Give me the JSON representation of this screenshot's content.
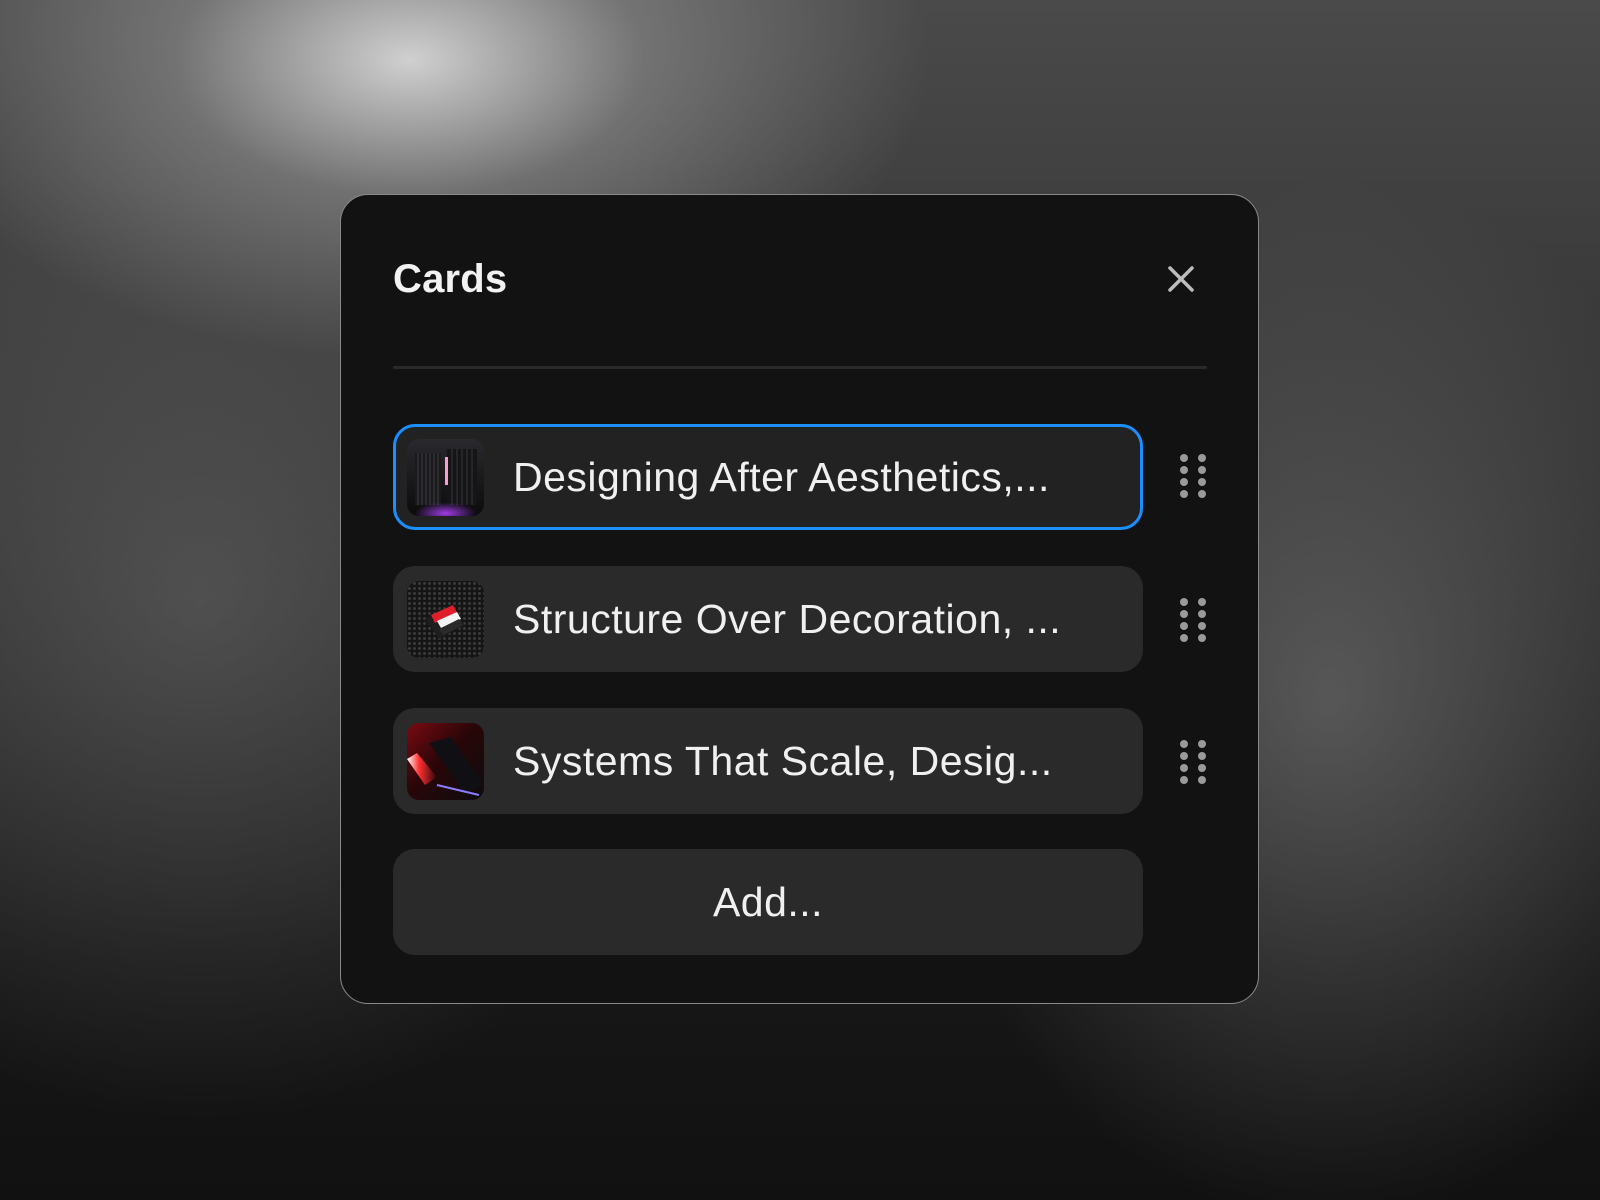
{
  "panel": {
    "title": "Cards",
    "close_icon": "close-icon",
    "add_label": "Add..."
  },
  "cards": [
    {
      "label": "Designing After Aesthetics,...",
      "thumbnail": "dark-cube-image",
      "selected": true,
      "handle_icon": "drag-handle-icon"
    },
    {
      "label": "Structure Over Decoration, ...",
      "thumbnail": "dark-sphere-card-image",
      "selected": false,
      "handle_icon": "drag-handle-icon"
    },
    {
      "label": "Systems That Scale, Desig...",
      "thumbnail": "red-light-slab-image",
      "selected": false,
      "handle_icon": "drag-handle-icon"
    }
  ],
  "colors": {
    "selected_border": "#1a8fff",
    "panel_background": "#121212",
    "card_background": "#2a2a2a",
    "text": "#f0f0f0"
  }
}
